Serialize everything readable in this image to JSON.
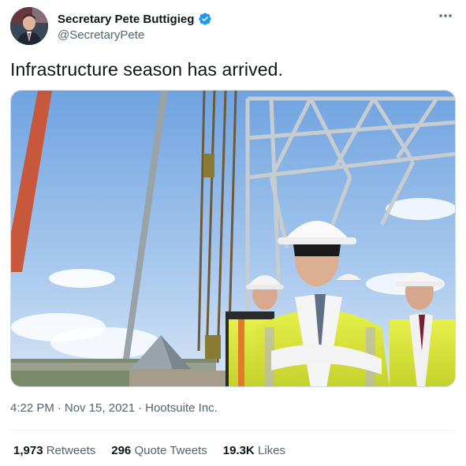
{
  "tweet": {
    "author": {
      "display_name": "Secretary Pete Buttigieg",
      "handle": "@SecretaryPete",
      "verified": true
    },
    "more_icon": "more-horizontal-icon",
    "text": "Infrastructure season has arrived.",
    "time": "4:22 PM",
    "separator": "·",
    "date": "Nov 15, 2021",
    "source": "Hootsuite Inc."
  },
  "stats": [
    {
      "value": "1,973",
      "label": "Retweets"
    },
    {
      "value": "296",
      "label": "Quote Tweets"
    },
    {
      "value": "19.3K",
      "label": "Likes"
    }
  ],
  "colors": {
    "text_primary": "#0f1419",
    "text_secondary": "#536471",
    "verified_blue": "#1d9bf0",
    "divider": "#eff3f4"
  }
}
